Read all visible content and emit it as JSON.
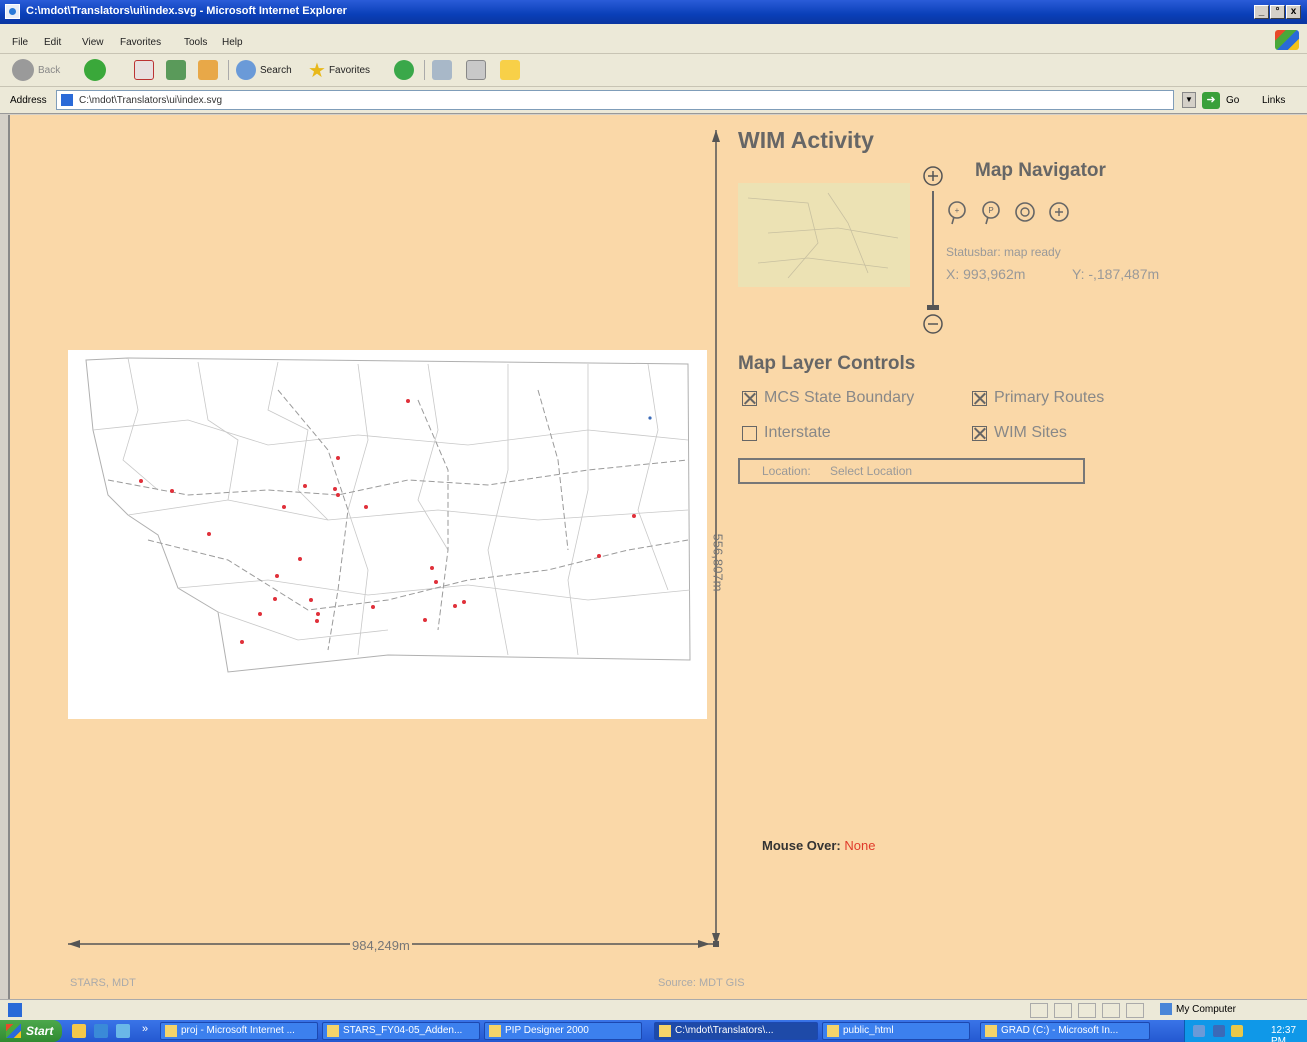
{
  "window": {
    "title": "C:\\mdot\\Translators\\ui\\index.svg - Microsoft Internet Explorer",
    "controls": [
      "_",
      "°",
      "x"
    ]
  },
  "menu": [
    "File",
    "Edit",
    "View",
    "Favorites",
    "Tools",
    "Help"
  ],
  "toolbar": {
    "back": "Back",
    "search": "Search",
    "favorites": "Favorites"
  },
  "address": {
    "label": "Address",
    "value": "C:\\mdot\\Translators\\ui\\index.svg",
    "go": "Go",
    "links": "Links"
  },
  "app": {
    "title": "WIM Activity",
    "navigator": {
      "title": "Map Navigator",
      "status": "Statusbar: map ready",
      "x": "X: 993,962m",
      "y": "Y: -,187,487m",
      "tools": [
        "zoom-in-tool",
        "pan-tool",
        "recenter-tool",
        "full-extent-tool"
      ]
    },
    "layers": {
      "title": "Map Layer Controls",
      "items": [
        {
          "label": "MCS State Boundary",
          "checked": true
        },
        {
          "label": "Primary Routes",
          "checked": true
        },
        {
          "label": "Interstate",
          "checked": false
        },
        {
          "label": "WIM Sites",
          "checked": true
        }
      ]
    },
    "location": {
      "label": "Location:",
      "value": "Select Location"
    },
    "scale": {
      "horizontal": "984,249m",
      "vertical": "556,807m"
    },
    "mouse_over": {
      "label": "Mouse Over:",
      "value": "None"
    },
    "footer": {
      "left": "STARS, MDT",
      "right": "Source: MDT GIS"
    },
    "colors": {
      "background": "#fad8a8",
      "wim_site": "#e0303a",
      "accent": "#e03a2a"
    }
  },
  "status": {
    "zone": "My Computer"
  },
  "taskbar": {
    "start": "Start",
    "tasks": [
      "proj - Microsoft Internet ...",
      "STARS_FY04-05_Adden...",
      "PIP Designer 2000",
      "C:\\mdot\\Translators\\...",
      "public_html",
      "GRAD (C:) - Microsoft In..."
    ],
    "clock": "12:37 PM"
  }
}
